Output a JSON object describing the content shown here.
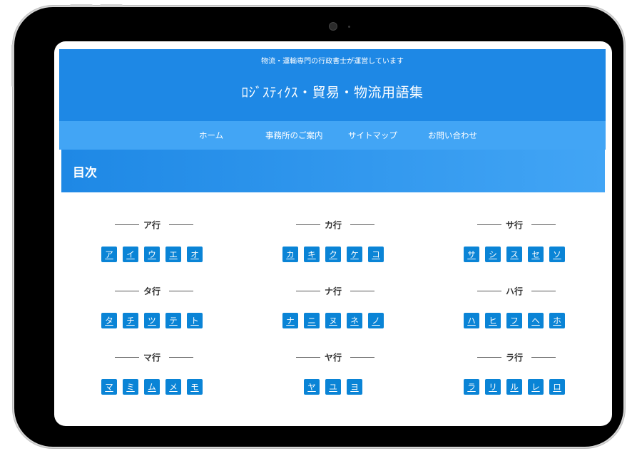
{
  "header": {
    "tagline": "物流・運輸専門の行政書士が運営しています",
    "site_title": "ﾛｼﾞｽﾃｨｸｽ・貿易・物流用語集"
  },
  "nav": {
    "items": [
      "ホーム",
      "事務所のご案内",
      "サイトマップ",
      "お問い合わせ"
    ]
  },
  "toc": {
    "title": "目次"
  },
  "groups": [
    {
      "label": "ア行",
      "chars": [
        "ア",
        "イ",
        "ウ",
        "エ",
        "オ"
      ]
    },
    {
      "label": "カ行",
      "chars": [
        "カ",
        "キ",
        "ク",
        "ケ",
        "コ"
      ]
    },
    {
      "label": "サ行",
      "chars": [
        "サ",
        "シ",
        "ス",
        "セ",
        "ソ"
      ]
    },
    {
      "label": "タ行",
      "chars": [
        "タ",
        "チ",
        "ツ",
        "テ",
        "ト"
      ]
    },
    {
      "label": "ナ行",
      "chars": [
        "ナ",
        "ニ",
        "ヌ",
        "ネ",
        "ノ"
      ]
    },
    {
      "label": "ハ行",
      "chars": [
        "ハ",
        "ヒ",
        "フ",
        "ヘ",
        "ホ"
      ]
    },
    {
      "label": "マ行",
      "chars": [
        "マ",
        "ミ",
        "ム",
        "メ",
        "モ"
      ]
    },
    {
      "label": "ヤ行",
      "chars": [
        "ヤ",
        "ユ",
        "ヨ"
      ]
    },
    {
      "label": "ラ行",
      "chars": [
        "ラ",
        "リ",
        "ル",
        "レ",
        "ロ"
      ]
    }
  ],
  "colors": {
    "header_bg": "#1e88e5",
    "nav_bg": "#42a5f5",
    "button_bg": "#0a84d6"
  }
}
